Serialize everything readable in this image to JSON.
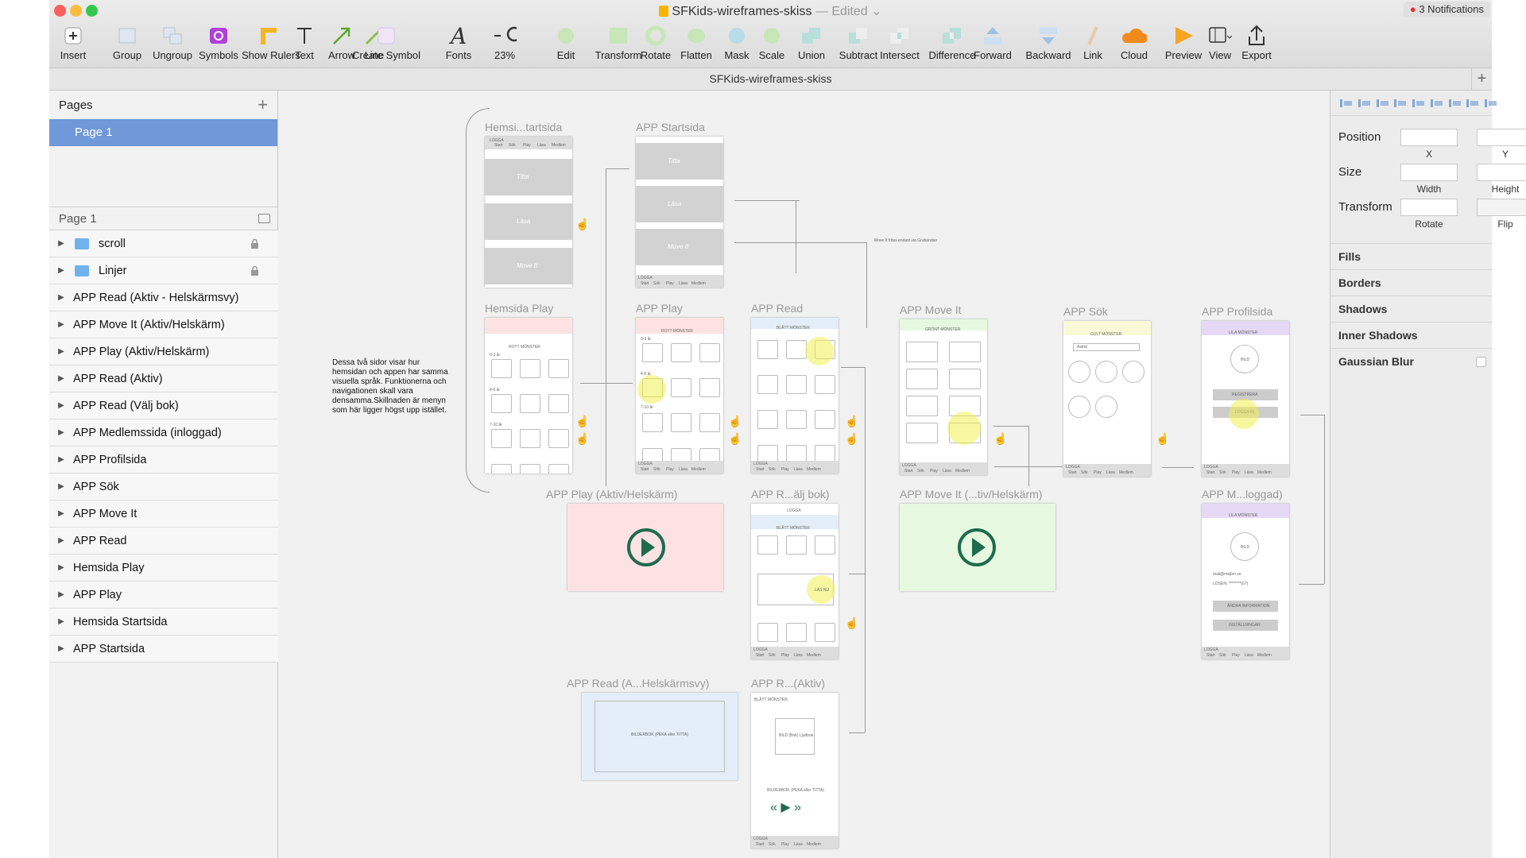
{
  "window": {
    "title": "SFKids-wireframes-skiss",
    "edited": "— Edited",
    "notifications": "3 Notifications",
    "tab_title": "SFKids-wireframes-skiss"
  },
  "toolbar": [
    {
      "label": "Insert",
      "icon": "plus-icon"
    },
    {
      "label": "Group",
      "icon": "group-icon"
    },
    {
      "label": "Ungroup",
      "icon": "ungroup-icon"
    },
    {
      "label": "Symbols",
      "icon": "symbols-icon"
    },
    {
      "label": "Show Rulers",
      "icon": "rulers-icon"
    },
    {
      "label": "Text",
      "icon": "text-icon"
    },
    {
      "label": "Arrow",
      "icon": "arrow-icon"
    },
    {
      "label": "Line",
      "icon": "line-icon"
    },
    {
      "label": "Create Symbol",
      "icon": "create-symbol-icon"
    },
    {
      "label": "Fonts",
      "icon": "fonts-icon"
    },
    {
      "label": "23%",
      "icon": "zoom-icon"
    },
    {
      "label": "Edit",
      "icon": "edit-icon"
    },
    {
      "label": "Transform",
      "icon": "transform-icon"
    },
    {
      "label": "Rotate",
      "icon": "rotate-icon"
    },
    {
      "label": "Flatten",
      "icon": "flatten-icon"
    },
    {
      "label": "Mask",
      "icon": "mask-icon"
    },
    {
      "label": "Scale",
      "icon": "scale-icon"
    },
    {
      "label": "Union",
      "icon": "union-icon"
    },
    {
      "label": "Subtract",
      "icon": "subtract-icon"
    },
    {
      "label": "Intersect",
      "icon": "intersect-icon"
    },
    {
      "label": "Difference",
      "icon": "difference-icon"
    },
    {
      "label": "Forward",
      "icon": "forward-icon"
    },
    {
      "label": "Backward",
      "icon": "backward-icon"
    },
    {
      "label": "Link",
      "icon": "link-icon"
    },
    {
      "label": "Cloud",
      "icon": "cloud-icon"
    },
    {
      "label": "Preview",
      "icon": "preview-icon"
    },
    {
      "label": "View",
      "icon": "view-icon"
    },
    {
      "label": "Export",
      "icon": "export-icon"
    }
  ],
  "sidebar": {
    "pages_header": "Pages",
    "selected_page": "Page 1",
    "layers_header": "Page 1",
    "layers": [
      {
        "label": "scroll",
        "folder": true,
        "locked": true
      },
      {
        "label": "Linjer",
        "folder": true,
        "locked": true
      },
      {
        "label": "APP Read (Aktiv - Helskärmsvy)"
      },
      {
        "label": "APP Move It (Aktiv/Helskärm)"
      },
      {
        "label": "APP Play (Aktiv/Helskärm)"
      },
      {
        "label": "APP Read (Aktiv)"
      },
      {
        "label": "APP Read (Välj bok)"
      },
      {
        "label": "APP Medlemssida (inloggad)"
      },
      {
        "label": "APP Profilsida"
      },
      {
        "label": "APP Sök"
      },
      {
        "label": "APP Move It"
      },
      {
        "label": "APP Read"
      },
      {
        "label": "Hemsida Play"
      },
      {
        "label": "APP Play"
      },
      {
        "label": "Hemsida Startsida"
      },
      {
        "label": "APP Startsida"
      }
    ]
  },
  "inspector": {
    "position": "Position",
    "x": "X",
    "y": "Y",
    "size": "Size",
    "width": "Width",
    "height": "Height",
    "transform": "Transform",
    "rotate": "Rotate",
    "flip": "Flip",
    "sections": [
      "Fills",
      "Borders",
      "Shadows",
      "Inner Shadows",
      "Gaussian Blur"
    ]
  },
  "canvas": {
    "note": "Dessa två sidor visar hur hemsidan och appen har samma visuella språk. Funktionerna och navigationen skall vara densamma.Skillnaden är menyn som här ligger högst upp istället.",
    "move_note": "Move It fritas endast via Grubandan",
    "artboards": [
      {
        "label": "Hemsi...tartsida"
      },
      {
        "label": "APP Startsida"
      },
      {
        "label": "Hemsida Play"
      },
      {
        "label": "APP Play"
      },
      {
        "label": "APP Read"
      },
      {
        "label": "APP Move It"
      },
      {
        "label": "APP Sök"
      },
      {
        "label": "APP Profilsida"
      },
      {
        "label": "APP Play (Aktiv/Helskärm)"
      },
      {
        "label": "APP R...älj bok)"
      },
      {
        "label": "APP Move It (...tiv/Helskärm)"
      },
      {
        "label": "APP M...loggad)"
      },
      {
        "label": "APP Read (A...Helskärmsvy)"
      },
      {
        "label": "APP R...(Aktiv)"
      }
    ],
    "wire": {
      "logga": "LOGGA",
      "start": "Start",
      "sok": "Sök",
      "play": "Play",
      "lasa": "Läsa",
      "medlem": "Medlem",
      "title": "Titta",
      "lasa_big": "Läsa",
      "move": "Move It",
      "rott": "ROTT MÖNSTER",
      "blatt": "BLÅTT MÖNSTER",
      "gront": "GRÖNT MÖNSTER",
      "gult": "GULT MÖNSTER",
      "lila": "LILA MÖNSTER",
      "bild": "BILD",
      "registrera": "REGISTRERA",
      "logga_in": "LOGGA IN",
      "andra_info": "ÄNDRA INFORMATION",
      "installningar": "INSTÄLLNINGAR",
      "bilderbok": "BILDERBOK (PEKA eller TITTA)",
      "bild_bok": "BILD (Bok) Ljudbok",
      "las_nu": "LÄS NU",
      "age1": "0-3 år",
      "age2": "4-6 år",
      "age3": "7-10 år",
      "sok_field": "Astrid",
      "email": "mail@mejlen.se",
      "pass": "LÖSEN: ********(67)"
    }
  },
  "colors": {
    "selection": "#6f99d8",
    "pink": "#fde2e4",
    "green": "#e6f9e0",
    "blue": "#e3eef8",
    "purple": "#e6d9f5",
    "yellow": "#fbfad8",
    "play_icon": "#1e6b4e"
  }
}
